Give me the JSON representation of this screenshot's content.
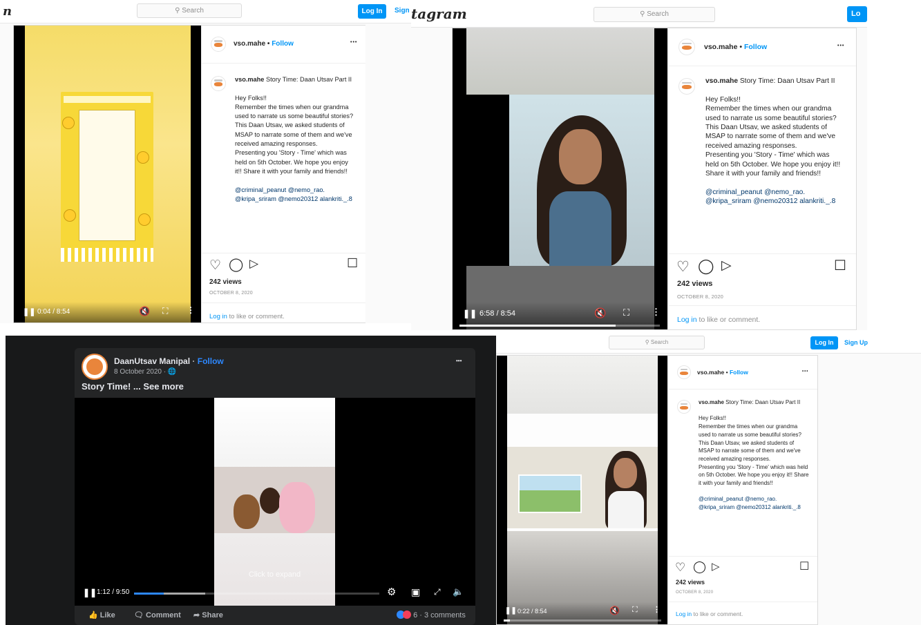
{
  "common": {
    "search_placeholder": "Search",
    "login": "Log In",
    "signup": "Sign Up",
    "user": "vso.mahe",
    "follow": "Follow",
    "dots": "•••",
    "caption_title": "Story Time: Daan Utsav Part II",
    "caption_lines": [
      "Hey Folks!!",
      "Remember the times when our grandma used to narrate us some beautiful stories? This Daan Utsav, we asked students of MSAP to narrate some of them and we've received amazing responses.",
      "Presenting you 'Story - Time' which was held on 5th October. We hope you enjoy it!! Share it with your family and friends!!"
    ],
    "mentions": "@criminal_peanut @nemo_rao. @kripa_sriram @nemo20312 alankriti._.8",
    "views": "242 views",
    "date": "October 8, 2020",
    "login_link": "Log in",
    "login_rest": "to like or comment."
  },
  "panel1": {
    "logo": "n",
    "signup": "Sign",
    "time": "0:04 / 8:54",
    "progress": 0.008
  },
  "panel2": {
    "logo": "tagram",
    "login": "Lo",
    "time": "6:58 / 8:54",
    "progress": 0.78
  },
  "panel4": {
    "time": "0:22 / 8:54",
    "progress": 0.04
  },
  "panel3": {
    "page_name": "DaanUtsav Manipal",
    "follow": "Follow",
    "date": "8 October 2020 · ",
    "text": "Story Time! ... See more",
    "overlay": "Click to expand",
    "time": "1:12 / 9:50",
    "progress": 0.12,
    "buffered": 0.29,
    "like": "Like",
    "comment": "Comment",
    "share": "Share",
    "reactions": "6 · 3 comments",
    "dots": "•••"
  },
  "colors": {
    "ig_blue": "#0095f6",
    "fb_bg": "#18191a",
    "fb_card": "#242526",
    "fb_blue": "#2d88ff"
  },
  "icons": [
    "heart-icon",
    "comment-icon",
    "share-icon",
    "bookmark-icon",
    "pause-icon",
    "mute-icon",
    "fullscreen-icon",
    "settings-icon",
    "globe-icon",
    "like-icon"
  ]
}
